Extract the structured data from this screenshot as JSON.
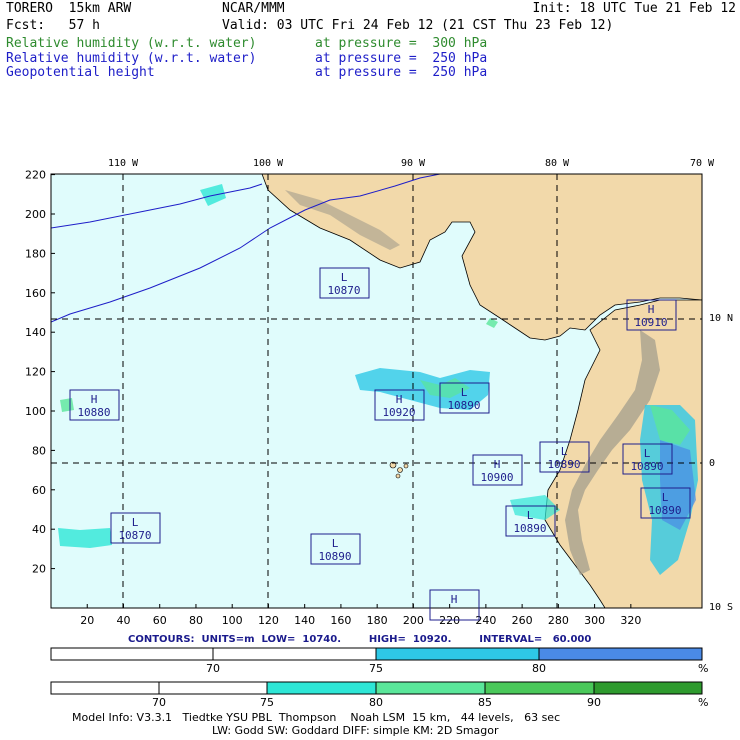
{
  "header": {
    "model": "TORERO  15km ARW",
    "org": "NCAR/MMM",
    "init": "Init: 18 UTC Tue 21 Feb 12",
    "fcst": "Fcst:   57 h",
    "valid": "Valid: 03 UTC Fri 24 Feb 12 (21 CST Thu 23 Feb 12)",
    "fields": [
      {
        "name": "Relative humidity (w.r.t. water)",
        "level": "at pressure =  300 hPa",
        "color": "#2e8b2e"
      },
      {
        "name": "Relative humidity (w.r.t. water)",
        "level": "at pressure =  250 hPa",
        "color": "#1e1ec8"
      },
      {
        "name": "Geopotential height",
        "level": "at pressure =  250 hPa",
        "color": "#1e1ec8"
      }
    ]
  },
  "map": {
    "lon_labels": [
      "110 W",
      "100 W",
      "90 W",
      "80 W",
      "70 W"
    ],
    "lat_labels": [
      "10 N",
      "0",
      "10 S"
    ],
    "x_ticks": [
      "20",
      "40",
      "60",
      "80",
      "100",
      "120",
      "140",
      "160",
      "180",
      "200",
      "220",
      "240",
      "260",
      "280",
      "300",
      "320"
    ],
    "y_ticks": [
      "220",
      "200",
      "180",
      "160",
      "140",
      "120",
      "100",
      "80",
      "60",
      "40",
      "20"
    ],
    "centers": [
      {
        "type": "L",
        "value": "10870"
      },
      {
        "type": "H",
        "value": "10910"
      },
      {
        "type": "H",
        "value": "10880"
      },
      {
        "type": "H",
        "value": "10920"
      },
      {
        "type": "L",
        "value": "10890"
      },
      {
        "type": "L",
        "value": "10890"
      },
      {
        "type": "H",
        "value": "10900"
      },
      {
        "type": "L",
        "value": "10890"
      },
      {
        "type": "L",
        "value": "10890"
      },
      {
        "type": "L",
        "value": "10890"
      },
      {
        "type": "L",
        "value": "10870"
      },
      {
        "type": "L",
        "value": "10890"
      },
      {
        "type": "H",
        "value": ""
      }
    ],
    "colors": {
      "ocean": "#e0fcfc",
      "land": "#f2d9aa",
      "mountain": "#a39d8c",
      "grid": "#000000",
      "box": "#1e1e8c"
    }
  },
  "contours_line": "CONTOURS:  UNITS=m  LOW=  10740.        HIGH=  10920.        INTERVAL=   60.000",
  "colorbar1": {
    "labels": [
      "70",
      "75",
      "80",
      "%"
    ],
    "colors": [
      "#ffffff",
      "#ffffff",
      "#2ec8e6",
      "#4a8ae6"
    ]
  },
  "colorbar2": {
    "labels": [
      "70",
      "75",
      "80",
      "85",
      "90",
      "%"
    ],
    "colors": [
      "#ffffff",
      "#ffffff",
      "#2ee6d6",
      "#5ae69a",
      "#4ac85a",
      "#2e9a2e"
    ]
  },
  "footer": {
    "line1": "Model Info: V3.3.1   Tiedtke YSU PBL  Thompson    Noah LSM  15 km,   44 levels,   63 sec",
    "line2": "LW: Godd SW: Goddard DIFF: simple KM: 2D Smagor"
  }
}
